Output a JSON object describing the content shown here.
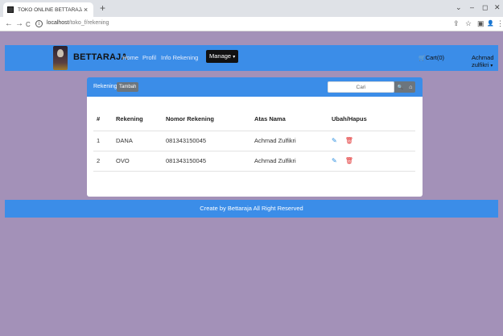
{
  "browser": {
    "tab_title": "TOKO ONLINE BETTARAJA",
    "tab_close": "×",
    "new_tab": "+",
    "url_host": "localhost",
    "url_path": "/toko_f/rekening",
    "back": "←",
    "forward": "→",
    "reload": "C",
    "info": "i",
    "icons": {
      "share": "⇪",
      "star": "☆",
      "sidebar": "▣",
      "profile": "👤",
      "menu": "⋮"
    },
    "window": {
      "chevron": "⌄",
      "minimize": "–",
      "maximize": "◻",
      "close": "✕"
    }
  },
  "navbar": {
    "brand": "BETTARAJA",
    "links": [
      "Home",
      "Profil",
      "Info Rekening"
    ],
    "manage": "Manage",
    "caret": "▾",
    "cart_icon": "🛒",
    "cart": "Cart(0)",
    "user": "Achmad zulfikri"
  },
  "card": {
    "title": "Rekening",
    "add_button": "Tambah",
    "search_placeholder": "Cari",
    "search_icon": "🔍",
    "home_icon": "⌂"
  },
  "table": {
    "headers": [
      "#",
      "Rekening",
      "Nomor Rekening",
      "Atas Nama",
      "Ubah/Hapus"
    ],
    "rows": [
      {
        "no": "1",
        "rekening": "DANA",
        "nomor": "081343150045",
        "nama": "Achmad Zulfikri"
      },
      {
        "no": "2",
        "rekening": "OVO",
        "nomor": "081343150045",
        "nama": "Achmad Zulfikri"
      }
    ],
    "edit_icon": "✎",
    "delete_icon": "🗑"
  },
  "footer": {
    "text": "Create by Bettaraja All Right Reserved"
  },
  "colors": {
    "navbar": "#3b8de8",
    "background": "#a391b8",
    "manage": "#111111",
    "delete": "#e02a2a",
    "edit": "#2a8ee0"
  }
}
